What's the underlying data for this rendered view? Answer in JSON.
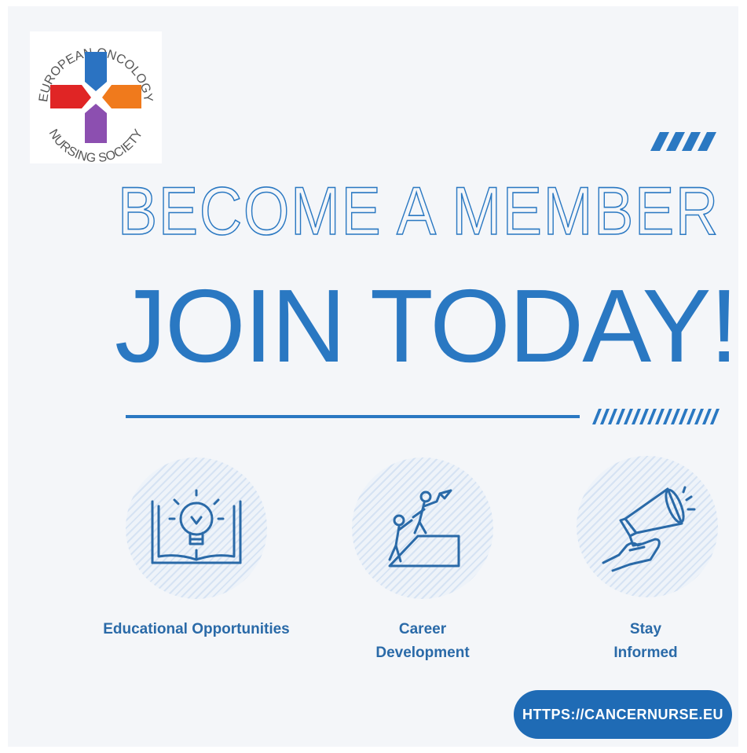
{
  "logo": {
    "top_text": "EUROPEAN ONCOLOGY",
    "bottom_text": "NURSING SOCIETY",
    "colors": {
      "blue": "#2b73c2",
      "red": "#e02525",
      "orange": "#f07a1c",
      "purple": "#8c4fb0"
    }
  },
  "headline": {
    "outline_text": "BECOME A MEMBER",
    "main_text": "JOIN TODAY!"
  },
  "features": [
    {
      "label": "Educational Opportunities",
      "icon": "lightbulb-book-icon"
    },
    {
      "label": "Career\nDevelopment",
      "icon": "climbing-people-icon"
    },
    {
      "label": "Stay\nInformed",
      "icon": "megaphone-icon"
    }
  ],
  "cta": {
    "url_label": "HTTPS://CANCERNURSE.EU"
  },
  "colors": {
    "accent": "#2a78c2",
    "button": "#1f6bb5",
    "label": "#2a6aa8",
    "background": "#f4f6f9"
  }
}
